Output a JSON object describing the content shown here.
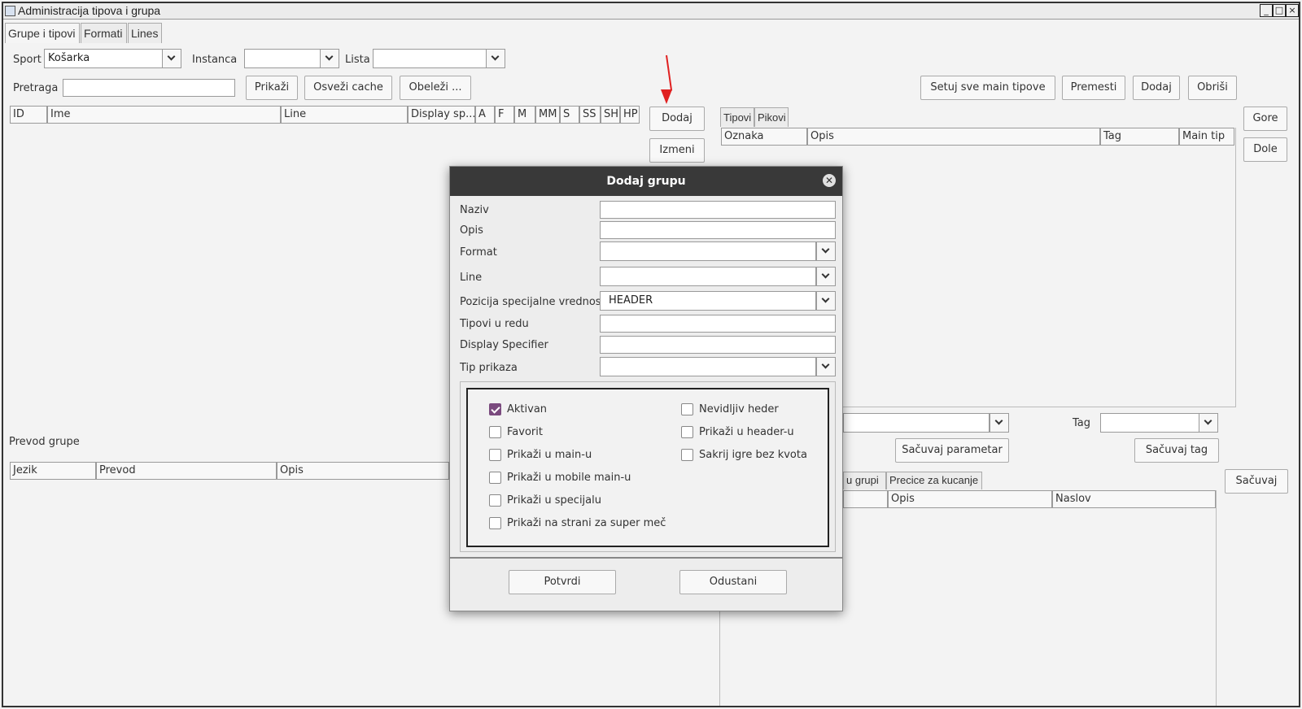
{
  "window": {
    "title": "Administracija tipova i grupa",
    "controls": [
      "_",
      "□",
      "×"
    ]
  },
  "tabs": [
    "Grupe i tipovi",
    "Formati",
    "Lines"
  ],
  "filters": {
    "sport_label": "Sport",
    "sport_value": "Košarka",
    "instanca_label": "Instanca",
    "instanca_value": "",
    "lista_label": "Lista",
    "lista_value": "",
    "pretraga_label": "Pretraga",
    "pretraga_value": ""
  },
  "left_buttons": {
    "prikazi": "Prikaži",
    "osvezi": "Osveži cache",
    "obelezi": "Obeleži ..."
  },
  "groups_table": {
    "columns": [
      "ID",
      "Ime",
      "Line",
      "Display sp...",
      "A",
      "F",
      "M",
      "MM",
      "S",
      "SS",
      "SH",
      "HP"
    ]
  },
  "group_buttons": {
    "dodaj": "Dodaj",
    "izmeni": "Izmeni"
  },
  "right_top_buttons": {
    "setuj": "Setuj sve main tipove",
    "premesti": "Premesti",
    "dodaj": "Dodaj",
    "obrisi": "Obriši"
  },
  "right_tabs": [
    "Tipovi",
    "Pikovi"
  ],
  "types_table": {
    "columns": [
      "Oznaka",
      "Opis",
      "Tag",
      "Main tip"
    ]
  },
  "side_buttons": {
    "gore": "Gore",
    "dole": "Dole",
    "sacuvaj": "Sačuvaj"
  },
  "right_lower": {
    "tag_label": "Tag",
    "sacuvaj_parametar": "Sačuvaj parametar",
    "sacuvaj_tag": "Sačuvaj tag",
    "tabs": [
      "u grupi",
      "Precice za kucanje"
    ],
    "columns": [
      "Opis",
      "Naslov"
    ]
  },
  "translation": {
    "label": "Prevod grupe",
    "columns": [
      "Jezik",
      "Prevod",
      "Opis"
    ]
  },
  "dialog": {
    "title": "Dodaj grupu",
    "fields": {
      "naziv": "Naziv",
      "opis": "Opis",
      "format": "Format",
      "line": "Line",
      "pozicija": "Pozicija specijalne vrednosti",
      "pozicija_value": "HEADER",
      "tipovi": "Tipovi u redu",
      "display": "Display Specifier",
      "tip_prikaza": "Tip prikaza"
    },
    "checkboxes": [
      {
        "label": "Aktivan",
        "checked": true
      },
      {
        "label": "Favorit",
        "checked": false
      },
      {
        "label": "Prikaži u main-u",
        "checked": false
      },
      {
        "label": "Prikaži u mobile main-u",
        "checked": false
      },
      {
        "label": "Prikaži u specijalu",
        "checked": false
      },
      {
        "label": "Prikaži na strani za super meč",
        "checked": false
      },
      {
        "label": "Nevidljiv heder",
        "checked": false
      },
      {
        "label": "Prikaži u header-u",
        "checked": false
      },
      {
        "label": "Sakrij igre bez kvota",
        "checked": false
      }
    ],
    "confirm": "Potvrdi",
    "cancel": "Odustani"
  },
  "colors": {
    "accent_checkbox": "#7a4a7e",
    "dialog_title_bg": "#393939",
    "annotation_arrow": "#e02020"
  }
}
